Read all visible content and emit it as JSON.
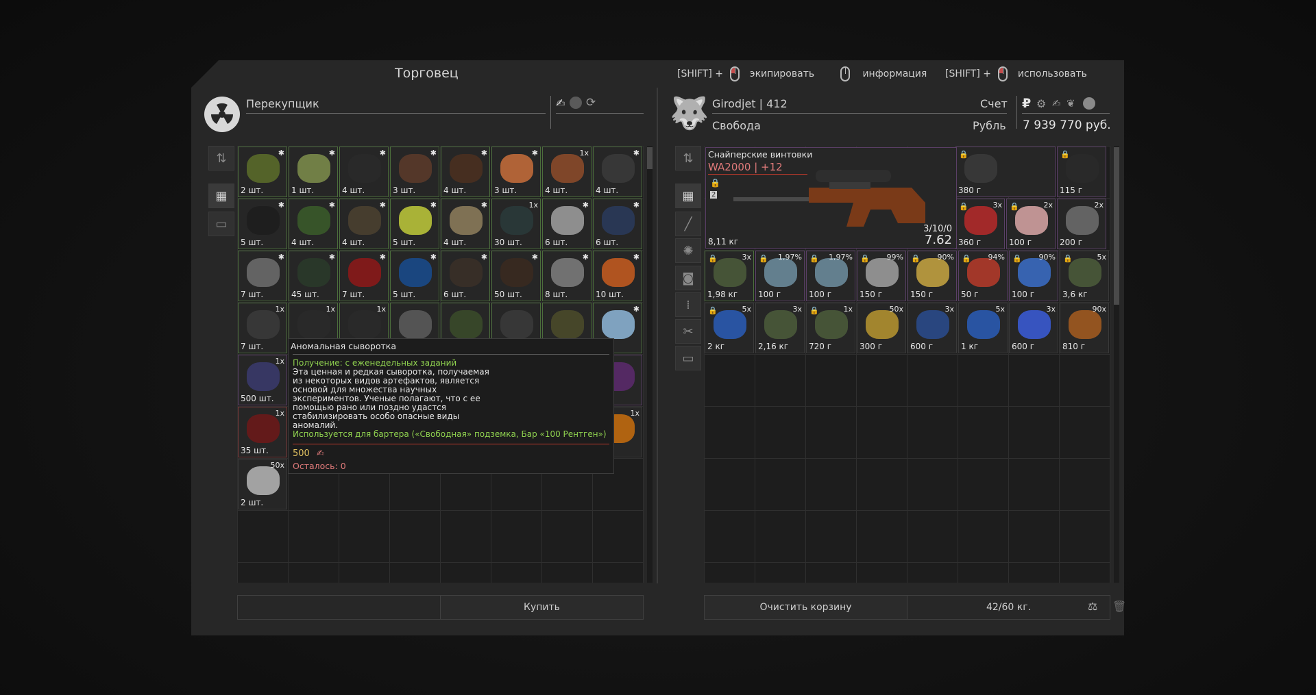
{
  "window": {
    "title": "Торговец"
  },
  "hints": [
    {
      "prefix": "[SHIFT] +",
      "label": "экипировать",
      "button": "left"
    },
    {
      "prefix": "",
      "label": "информация",
      "button": "none"
    },
    {
      "prefix": "[SHIFT] +",
      "label": "использовать",
      "button": "left"
    }
  ],
  "trader": {
    "name": "Перекупщик",
    "buy_label": "Купить"
  },
  "player": {
    "name": "Girodjet | 412",
    "faction": "Свобода",
    "account_label": "Счет",
    "currency_label": "Рубль",
    "balance": "7 939 770 руб.",
    "clear_cart_label": "Очистить корзину",
    "weight": "42/60 кг."
  },
  "trader_items": [
    {
      "q": "2 шт.",
      "c": "✱",
      "k": "#5a6a2a"
    },
    {
      "q": "1 шт.",
      "c": "✱",
      "k": "#7a8a4a"
    },
    {
      "q": "4 шт.",
      "c": "✱",
      "k": "#2a2a2a"
    },
    {
      "q": "3 шт.",
      "c": "✱",
      "k": "#5a3a2a"
    },
    {
      "q": "4 шт.",
      "c": "✱",
      "k": "#4a3020"
    },
    {
      "q": "3 шт.",
      "c": "✱",
      "k": "#c06a3a"
    },
    {
      "q": "4 шт.",
      "c": "1x",
      "k": "#8a4a2a"
    },
    {
      "q": "4 шт.",
      "c": "✱",
      "k": "#3a3a3a"
    },
    {
      "q": "5 шт.",
      "c": "✱",
      "k": "#1e1e1e"
    },
    {
      "q": "4 шт.",
      "c": "✱",
      "k": "#3a5a2a"
    },
    {
      "q": "4 шт.",
      "c": "✱",
      "k": "#4a4030"
    },
    {
      "q": "5 шт.",
      "c": "✱",
      "k": "#b8c23a"
    },
    {
      "q": "4 шт.",
      "c": "✱",
      "k": "#8a7a5a"
    },
    {
      "q": "30 шт.",
      "c": "1x",
      "k": "#2a3a3a"
    },
    {
      "q": "6 шт.",
      "c": "✱",
      "k": "#9a9a9a"
    },
    {
      "q": "6 шт.",
      "c": "✱",
      "k": "#2a3a5a"
    },
    {
      "q": "7 шт.",
      "c": "✱",
      "k": "#6a6a6a"
    },
    {
      "q": "45 шт.",
      "c": "✱",
      "k": "#2a3a2a"
    },
    {
      "q": "7 шт.",
      "c": "✱",
      "k": "#8a1a1a"
    },
    {
      "q": "5 шт.",
      "c": "✱",
      "k": "#1a4a8a"
    },
    {
      "q": "6 шт.",
      "c": "✱",
      "k": "#3a3028"
    },
    {
      "q": "50 шт.",
      "c": "✱",
      "k": "#3a2a20"
    },
    {
      "q": "8 шт.",
      "c": "✱",
      "k": "#7a7a7a"
    },
    {
      "q": "10 шт.",
      "c": "✱",
      "k": "#c05a20"
    },
    {
      "q": "7 шт.",
      "c": "1x",
      "k": "#3a3a3a"
    },
    {
      "q": "",
      "c": "1x",
      "k": "#2a2a2a"
    },
    {
      "q": "",
      "c": "1x",
      "k": "#2a2a2a"
    },
    {
      "q": "",
      "c": "",
      "k": "#5a5a5a"
    },
    {
      "q": "",
      "c": "",
      "k": "#3a4a2a"
    },
    {
      "q": "",
      "c": "",
      "k": "#3a3a3a"
    },
    {
      "q": "",
      "c": "",
      "k": "#4a4a2a"
    },
    {
      "q": "",
      "c": "✱",
      "k": "#8ab0d0"
    },
    {
      "q": "500 шт.",
      "c": "1x",
      "k": "#3a3a6a"
    },
    {
      "q": "",
      "c": "",
      "k": "#262626"
    },
    {
      "q": "",
      "c": "",
      "k": "#262626"
    },
    {
      "q": "",
      "c": "",
      "k": "#262626"
    },
    {
      "q": "",
      "c": "",
      "k": "#262626"
    },
    {
      "q": "",
      "c": "",
      "k": "#262626"
    },
    {
      "q": "",
      "c": "",
      "k": "#262626"
    },
    {
      "q": "шт.",
      "c": "",
      "k": "#5a2a6a"
    },
    {
      "q": "35 шт.",
      "c": "1x",
      "k": "#6a1a1a"
    },
    {
      "q": "",
      "c": "",
      "k": "#262626"
    },
    {
      "q": "",
      "c": "",
      "k": "#262626"
    },
    {
      "q": "",
      "c": "",
      "k": "#262626"
    },
    {
      "q": "",
      "c": "",
      "k": "#262626"
    },
    {
      "q": "",
      "c": "",
      "k": "#262626"
    },
    {
      "q": "",
      "c": "",
      "k": "#262626"
    },
    {
      "q": "шт.",
      "c": "1x",
      "k": "#c06a10"
    },
    {
      "q": "2 шт.",
      "c": "50x",
      "k": "#b0b0b0"
    }
  ],
  "featured_item": {
    "category": "Снайперские винтовки",
    "name": "WA2000 | +12",
    "weight": "8,11 кг",
    "ammo": "3/10/0",
    "caliber": "7.62"
  },
  "player_items_row1": [
    {
      "q": "380 г",
      "c": "",
      "lock": true,
      "k": "#3a3a3a",
      "w": 2
    },
    {
      "q": "115 г",
      "c": "",
      "lock": true,
      "k": "#2a2a2a",
      "w": 1
    }
  ],
  "player_items_row2": [
    {
      "q": "360 г",
      "c": "3x",
      "lock": true,
      "k": "#b02a2a"
    },
    {
      "q": "100 г",
      "c": "2x",
      "lock": true,
      "k": "#d0a0a0"
    },
    {
      "q": "200 г",
      "c": "2x",
      "lock": false,
      "k": "#6a6a6a"
    }
  ],
  "player_items": [
    {
      "q": "1,98 кг",
      "c": "3x",
      "lock": true,
      "k": "#4a5a3a",
      "b": "gr"
    },
    {
      "q": "100 г",
      "c": "1,97%",
      "lock": true,
      "k": "#6a8a9a",
      "b": "pu"
    },
    {
      "q": "100 г",
      "c": "1,97%",
      "lock": true,
      "k": "#6a8a9a",
      "b": "pu"
    },
    {
      "q": "150 г",
      "c": "99%",
      "lock": true,
      "k": "#9a9a9a",
      "b": "pu"
    },
    {
      "q": "150 г",
      "c": "90%",
      "lock": true,
      "k": "#c0a040",
      "b": "pu"
    },
    {
      "q": "50 г",
      "c": "94%",
      "lock": true,
      "k": "#b03a2a",
      "b": "pu"
    },
    {
      "q": "100 г",
      "c": "90%",
      "lock": true,
      "k": "#3a6ac0",
      "b": "pu"
    },
    {
      "q": "3,6 кг",
      "c": "5x",
      "lock": true,
      "k": "#4a5a3a",
      "b": ""
    },
    {
      "q": "2 кг",
      "c": "5x",
      "lock": true,
      "k": "#2a5ab0",
      "b": ""
    },
    {
      "q": "2,16 кг",
      "c": "3x",
      "lock": false,
      "k": "#4a5a3a",
      "b": ""
    },
    {
      "q": "720 г",
      "c": "1x",
      "lock": true,
      "k": "#4a5a3a",
      "b": ""
    },
    {
      "q": "300 г",
      "c": "50x",
      "lock": false,
      "k": "#b09030",
      "b": ""
    },
    {
      "q": "600 г",
      "c": "3x",
      "lock": false,
      "k": "#2a4a8a",
      "b": ""
    },
    {
      "q": "1 кг",
      "c": "5x",
      "lock": false,
      "k": "#2a5ab0",
      "b": ""
    },
    {
      "q": "600 г",
      "c": "3x",
      "lock": false,
      "k": "#3a5ad0",
      "b": ""
    },
    {
      "q": "810 г",
      "c": "90x",
      "lock": false,
      "k": "#a05a20",
      "b": ""
    }
  ],
  "tooltip": {
    "title": "Аномальная сыворотка",
    "obtain": "Получение: с еженедельных заданий",
    "desc": [
      "Эта ценная и редкая сыворотка, получаемая",
      "из некоторых видов артефактов, является",
      "основой для множества научных",
      "экспериментов. Ученые полагают, что с ее",
      "помощью рано или поздно удастся",
      "стабилизировать особо опасные виды",
      "аномалий."
    ],
    "usage": "Используется для бартера («Свободная» подземка, Бар «100 Рентген»)",
    "price": "500",
    "remaining": "Осталось: 0"
  },
  "colors": {
    "accent_red": "#c0392b",
    "name_pink": "#e07a7a",
    "usage_green": "#8fd14f",
    "price_yellow": "#e0c060"
  }
}
